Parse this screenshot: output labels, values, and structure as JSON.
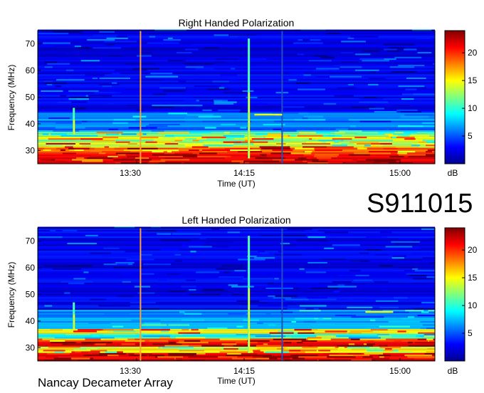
{
  "observation_id": "S911015",
  "instrument": "Nancay Decameter Array",
  "chart_data": [
    {
      "type": "heatmap",
      "title": "Right Handed Polarization",
      "xlabel": "Time (UT)",
      "ylabel": "Frequency (MHz)",
      "xticks": [
        "13:30",
        "14:15",
        "15:00"
      ],
      "yticks": [
        30,
        40,
        50,
        60,
        70
      ],
      "ylim": [
        25,
        75
      ],
      "colorbar": {
        "label": "dB",
        "ticks": [
          5,
          10,
          15,
          20
        ],
        "range": [
          0,
          24
        ]
      },
      "features": [
        {
          "kind": "vertical-line",
          "time": "13:34"
        },
        {
          "kind": "vertical-line",
          "time": "14:25"
        },
        {
          "kind": "burst",
          "time": "14:13",
          "freq_range": [
            27,
            72
          ]
        },
        {
          "kind": "burst",
          "time": "13:10",
          "freq_range": [
            36,
            46
          ]
        },
        {
          "kind": "band",
          "freq": 43.5,
          "time_range": [
            "14:15",
            "14:25"
          ]
        }
      ]
    },
    {
      "type": "heatmap",
      "title": "Left Handed Polarization",
      "xlabel": "Time (UT)",
      "ylabel": "Frequency (MHz)",
      "xticks": [
        "13:30",
        "14:15",
        "15:00"
      ],
      "yticks": [
        30,
        40,
        50,
        60,
        70
      ],
      "ylim": [
        25,
        75
      ],
      "colorbar": {
        "label": "dB",
        "ticks": [
          5,
          10,
          15,
          20
        ],
        "range": [
          0,
          24
        ]
      },
      "features": [
        {
          "kind": "vertical-line",
          "time": "13:34"
        },
        {
          "kind": "vertical-line",
          "time": "14:25"
        },
        {
          "kind": "burst",
          "time": "14:13",
          "freq_range": [
            28,
            72
          ]
        },
        {
          "kind": "burst",
          "time": "13:10",
          "freq_range": [
            37,
            47
          ]
        },
        {
          "kind": "band",
          "freq": 43.5,
          "time_range": [
            "14:55",
            "15:05"
          ]
        }
      ]
    }
  ]
}
